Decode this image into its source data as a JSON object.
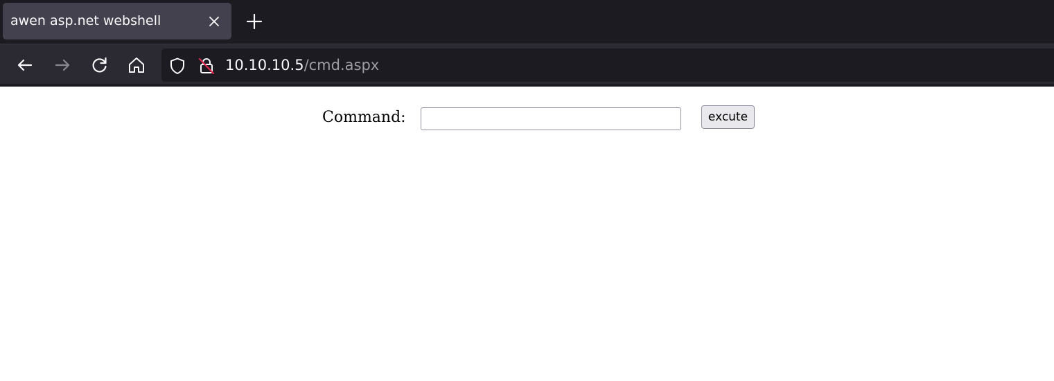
{
  "tab": {
    "title": "awen asp.net webshell",
    "close_icon": "close-icon",
    "new_tab_icon": "plus-icon"
  },
  "toolbar": {
    "back_icon": "arrow-left-icon",
    "forward_icon": "arrow-right-icon",
    "reload_icon": "reload-icon",
    "home_icon": "home-icon",
    "tracking_protection_icon": "shield-icon",
    "insecure_connection_icon": "lock-insecure-icon"
  },
  "url": {
    "host": "10.10.10.5",
    "path": "/cmd.aspx"
  },
  "form": {
    "label": "Command:",
    "input_value": "",
    "button_label": "excute"
  },
  "colors": {
    "tabstrip_bg": "#1c1b22",
    "active_tab_bg": "#42414d",
    "toolbar_bg": "#2b2a33",
    "url_text": "#fbfbfe",
    "url_path_text": "#9e9ea6",
    "insecure_slash": "#e22850"
  }
}
